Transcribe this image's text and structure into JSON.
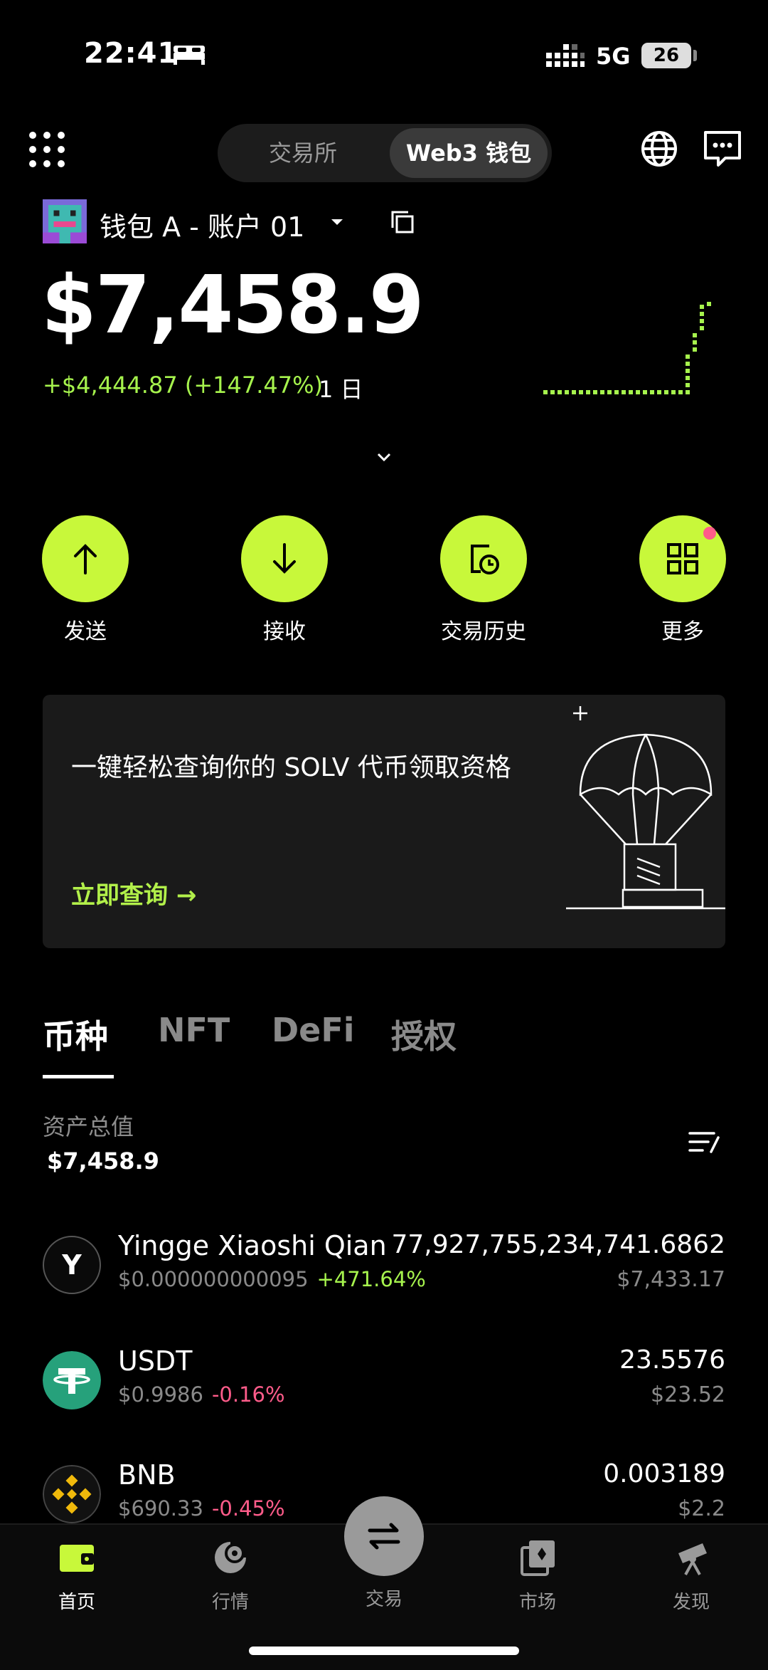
{
  "status": {
    "time": "22:41",
    "network": "5G",
    "battery": "26"
  },
  "topnav": {
    "segment_exchange": "交易所",
    "segment_wallet": "Web3 钱包"
  },
  "wallet": {
    "name": "钱包 A - 账户 01",
    "balance": "$7,458.9",
    "change": "+$4,444.87 (+147.47%)",
    "period": "1 日"
  },
  "actions": [
    {
      "label": "发送",
      "icon": "arrow-up-icon"
    },
    {
      "label": "接收",
      "icon": "arrow-down-icon"
    },
    {
      "label": "交易历史",
      "icon": "history-icon"
    },
    {
      "label": "更多",
      "icon": "apps-icon"
    }
  ],
  "banner": {
    "text": "一键轻松查询你的 SOLV 代币领取资格",
    "link": "立即查询 →"
  },
  "tabs": [
    "币种",
    "NFT",
    "DeFi",
    "授权"
  ],
  "assets": {
    "total_label": "资产总值",
    "total_value": "$7,458.9"
  },
  "tokens": [
    {
      "name": "Yingge Xiaoshi Qian",
      "price": "$0.000000000095",
      "change": "+471.64%",
      "amount": "77,927,755,234,741.6862",
      "value": "$7,433.17",
      "icon": "Y"
    },
    {
      "name": "USDT",
      "price": "$0.9986",
      "change": "-0.16%",
      "amount": "23.5576",
      "value": "$23.52",
      "icon": "tether-icon"
    },
    {
      "name": "BNB",
      "price": "$690.33",
      "change": "-0.45%",
      "amount": "0.003189",
      "value": "$2.2",
      "icon": "bnb-icon"
    }
  ],
  "bottom_nav": [
    {
      "label": "首页",
      "icon": "wallet-icon"
    },
    {
      "label": "行情",
      "icon": "market-icon"
    },
    {
      "label": "交易",
      "icon": "swap-icon"
    },
    {
      "label": "市场",
      "icon": "marketplace-icon"
    },
    {
      "label": "发现",
      "icon": "discover-icon"
    }
  ],
  "colors": {
    "accent": "#c8f83a",
    "positive": "#a6f34d",
    "negative": "#ff5c8a"
  }
}
